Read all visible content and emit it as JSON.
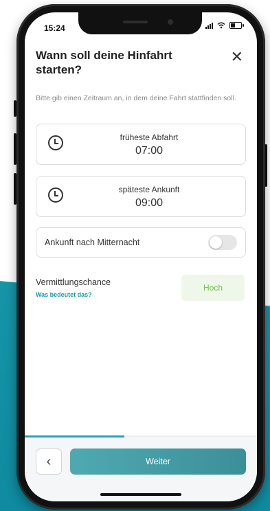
{
  "status": {
    "time": "15:24"
  },
  "header": {
    "title": "Wann soll deine Hinfahrt starten?",
    "close": "✕"
  },
  "subtitle": "Bitte gib einen Zeitraum an, in dem deine Fahrt stattfinden soll.",
  "earliest": {
    "label": "früheste Abfahrt",
    "time": "07:00"
  },
  "latest": {
    "label": "späteste Ankunft",
    "time": "09:00"
  },
  "midnight": {
    "label": "Ankunft nach Mitternacht",
    "enabled": false
  },
  "chance": {
    "label": "Vermittlungschance",
    "link": "Was bedeutet das?",
    "value": "Hoch"
  },
  "progress": {
    "fraction": 0.43
  },
  "footer": {
    "back": "‹",
    "next": "Weiter"
  },
  "colors": {
    "accent": "#1796a8",
    "chance": "#6fbf4a"
  }
}
